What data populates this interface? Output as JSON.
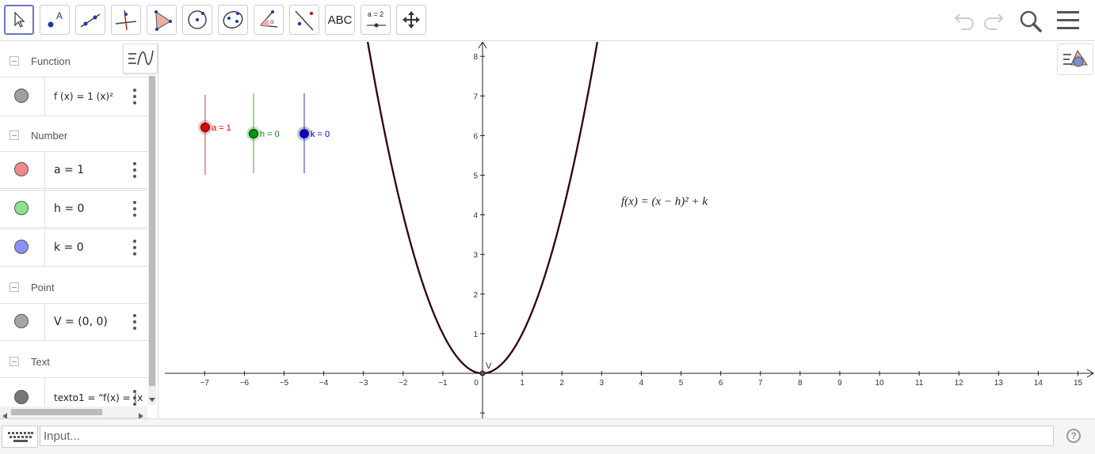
{
  "toolbar": {
    "tools": [
      {
        "name": "move-tool",
        "icon": "arrow-cursor-icon"
      },
      {
        "name": "point-tool",
        "icon": "point-icon"
      },
      {
        "name": "line-tool",
        "icon": "line-icon"
      },
      {
        "name": "perpendicular-tool",
        "icon": "perpendicular-icon"
      },
      {
        "name": "polygon-tool",
        "icon": "polygon-icon"
      },
      {
        "name": "circle-tool",
        "icon": "circle-icon"
      },
      {
        "name": "ellipse-tool",
        "icon": "ellipse-icon"
      },
      {
        "name": "angle-tool",
        "icon": "angle-icon"
      },
      {
        "name": "reflect-tool",
        "icon": "reflect-icon"
      },
      {
        "name": "text-tool",
        "icon": "text-icon",
        "label": "ABC"
      },
      {
        "name": "slider-tool",
        "icon": "slider-icon",
        "label": "a = 2"
      },
      {
        "name": "move-graphics-tool",
        "icon": "move-arrows-icon"
      }
    ],
    "undo_icon": "undo-icon",
    "redo_icon": "redo-icon",
    "search_icon": "search-icon",
    "menu_icon": "menu-icon"
  },
  "algebra": {
    "categories": {
      "function": "Function",
      "number": "Number",
      "point": "Point",
      "text": "Text"
    },
    "items": {
      "f": {
        "expr": "f (x)  =  1  (x)²",
        "color": "#a49c9e"
      },
      "a": {
        "expr": "a  =  1",
        "color": "#f08a8a"
      },
      "h": {
        "expr": "h  =  0",
        "color": "#8ee28e"
      },
      "k": {
        "expr": "k  =  0",
        "color": "#8e8ef8"
      },
      "v": {
        "expr": "V  =  (0, 0)",
        "color": "#a6a6a6"
      },
      "text1": {
        "expr": "texto1  =   “f(x) = (x",
        "color": "#777777"
      }
    }
  },
  "graphics": {
    "sliders": [
      {
        "label": "a = 1",
        "color": "#dd0000"
      },
      {
        "label": "h = 0",
        "color": "#009900"
      },
      {
        "label": "k = 0",
        "color": "#0000cc"
      }
    ],
    "formula": "f(x) = (x − h)² + k",
    "vertex_label": "V",
    "curve_color": "#330000",
    "x_ticks": [
      "−7",
      "−6",
      "−5",
      "−4",
      "−3",
      "−2",
      "−1",
      "0",
      "1",
      "2",
      "3",
      "4",
      "5",
      "6",
      "7",
      "8",
      "9",
      "10",
      "11",
      "12",
      "13",
      "14",
      "15"
    ],
    "y_ticks": [
      "1",
      "2",
      "3",
      "4",
      "5",
      "6",
      "7",
      "8"
    ]
  },
  "input": {
    "placeholder": "Input..."
  },
  "help": {
    "label": "?"
  }
}
